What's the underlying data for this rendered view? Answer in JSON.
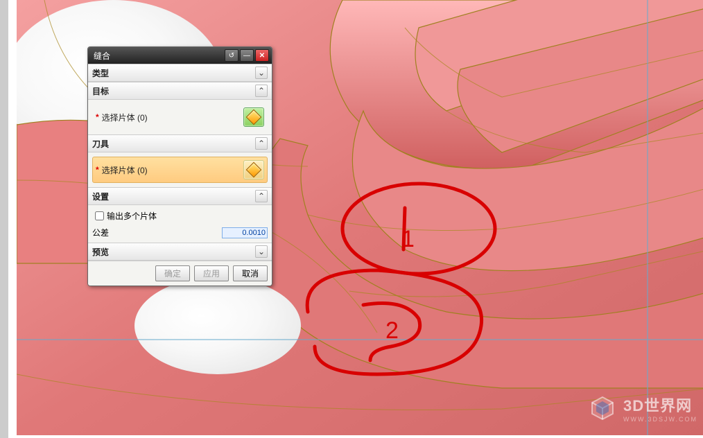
{
  "dialog": {
    "title": "缝合",
    "sections": {
      "type": {
        "label": "类型"
      },
      "target": {
        "label": "目标",
        "select_label": "选择片体 (0)"
      },
      "tool": {
        "label": "刀具",
        "select_label": "选择片体 (0)"
      },
      "settings": {
        "label": "设置",
        "output_multiple": "输出多个片体",
        "tolerance_label": "公差",
        "tolerance_value": "0.0010"
      },
      "preview": {
        "label": "预览"
      }
    },
    "buttons": {
      "ok": "确定",
      "apply": "应用",
      "cancel": "取消"
    }
  },
  "annotations": {
    "marker1": "1",
    "marker2": "2"
  },
  "watermark": {
    "title": "3D世界网",
    "url": "WWW.3DSJW.COM"
  }
}
